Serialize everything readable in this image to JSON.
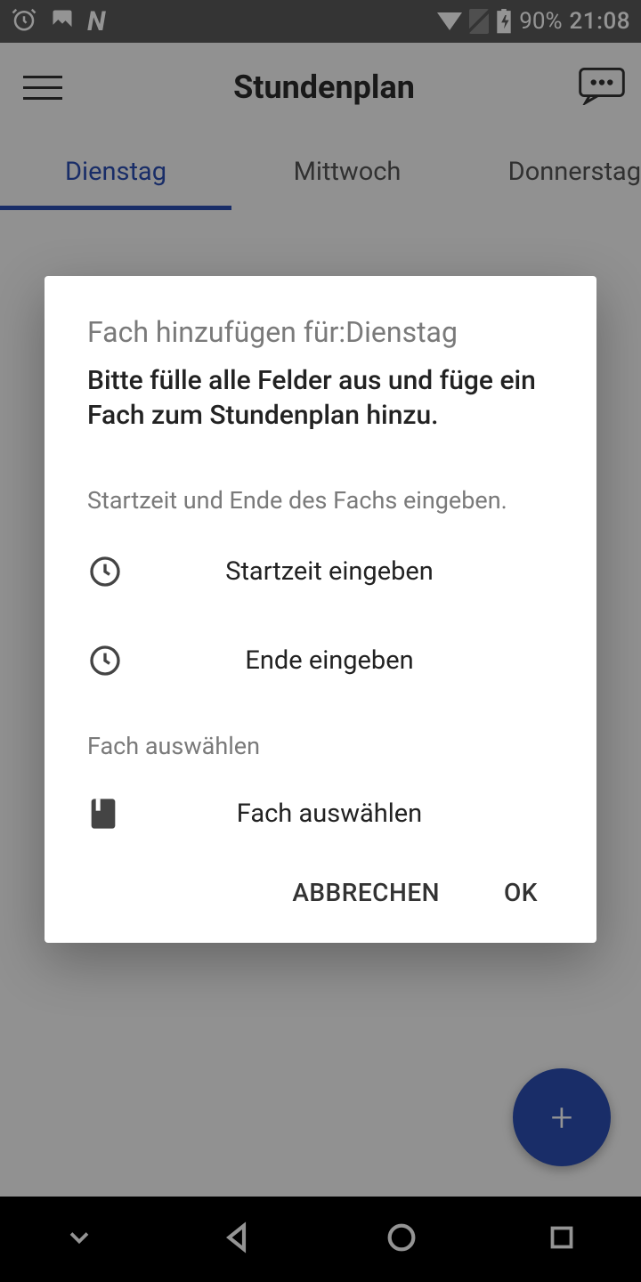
{
  "status": {
    "battery_pct": "90%",
    "time": "21:08"
  },
  "header": {
    "title": "Stundenplan"
  },
  "tabs": {
    "items": [
      {
        "label": "Dienstag",
        "active": true
      },
      {
        "label": "Mittwoch",
        "active": false
      },
      {
        "label": "Donnerstag",
        "active": false
      }
    ]
  },
  "dialog": {
    "title": "Fach hinzufügen für:Dienstag",
    "subtitle": "Bitte fülle alle Felder aus und füge ein Fach zum Stundenplan hinzu.",
    "time_section_label": "Startzeit und Ende des Fachs eingeben.",
    "start_label": "Startzeit eingeben",
    "end_label": "Ende eingeben",
    "subject_section_label": "Fach auswählen",
    "subject_label": "Fach auswählen",
    "cancel": "ABBRECHEN",
    "ok": "OK"
  },
  "fab": {
    "glyph": "+"
  }
}
